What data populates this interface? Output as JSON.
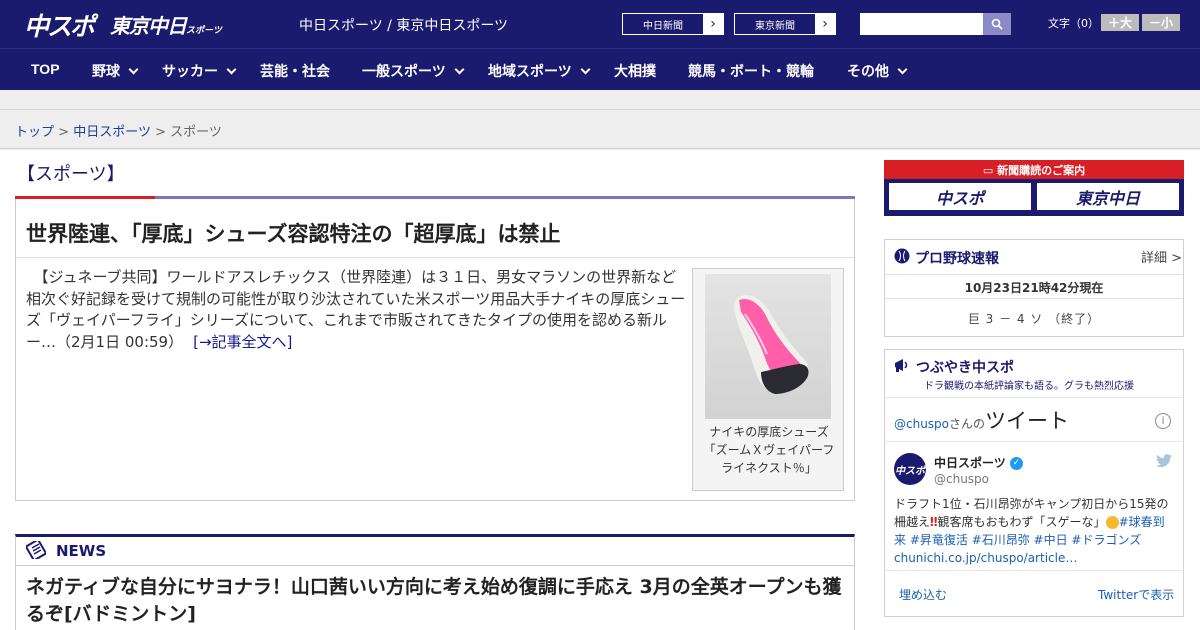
{
  "header": {
    "logo_chuspo": "中スポ",
    "logo_tokyo": "東京中日",
    "logo_tokyo_sub": "スポーツ",
    "sites_text": "中日スポーツ / 東京中日スポーツ",
    "site_buttons": [
      "中日新聞",
      "東京新聞"
    ],
    "font_label": "文字（0）",
    "font_bigger": "＋大",
    "font_smaller": "－小",
    "search_placeholder": ""
  },
  "nav": {
    "items": [
      "TOP",
      "野球",
      "サッカー",
      "芸能・社会",
      "一般スポーツ",
      "地域スポーツ",
      "大相撲",
      "競馬・ボート・競輪",
      "その他"
    ]
  },
  "breadcrumb": {
    "top": "トップ",
    "chunichi": "中日スポーツ",
    "current": "スポーツ",
    "sep": ">"
  },
  "main": {
    "section_title": "【スポーツ】",
    "article": {
      "headline": "世界陸連、「厚底」シューズ容認特注の「超厚底」は禁止",
      "body": "　【ジュネーブ共同】ワールドアスレチックス（世界陸連）は３１日、男女マラソンの世界新など相次ぐ好記録を受けて規制の可能性が取り沙汰されていた米スポーツ用品大手ナイキの厚底シューズ「ヴェイパーフライ」シリーズについて、これまで市販されてきたタイプの使用を認める新ルー…（2月1日 00:59）",
      "more_link": "[→記事全文へ]",
      "caption": "ナイキの厚底シューズ「ズームＸヴェイパーフライネクスト％」"
    },
    "news": {
      "label": "NEWS",
      "headline": "ネガティブな自分にサヨナラ！山口茜いい方向に考え始め復調に手応え 3月の全英オープンも獲るぞ[バドミントン]"
    }
  },
  "sidebar": {
    "ad": {
      "title": "新聞購読のご案内",
      "btn1": "中スポ",
      "btn2": "東京中日"
    },
    "baseball": {
      "title": "プロ野球速報",
      "detail": "詳細 >",
      "date": "10月23日21時42分現在",
      "score": "巨 3 － 4 ソ （終了）"
    },
    "tweets": {
      "title": "つぶやき中スポ",
      "subtitle": "ドラ観戦の本紙評論家も語る。グラも熱烈応援",
      "head_handle": "@chuspo",
      "head_san": "さんの",
      "head_tweet": "ツイート",
      "info": "i",
      "name": "中日スポーツ",
      "handle": "@chuspo",
      "text_plain": "ドラフト1位・石川昂弥がキャンプ初日から15発の柵越え",
      "text_mid": "観客席もおもわず「スゲーな」",
      "tags1": "#球春到来 #昇竜復活 #石川昂弥 #中日 #ドラゴンズ",
      "link": "chunichi.co.jp/chuspo/article…",
      "embed": "埋め込む",
      "view": "Twitterで表示"
    }
  },
  "colors": {
    "navy": "#1a1a6e",
    "red": "#d81f26",
    "link": "#1a5fb4"
  }
}
